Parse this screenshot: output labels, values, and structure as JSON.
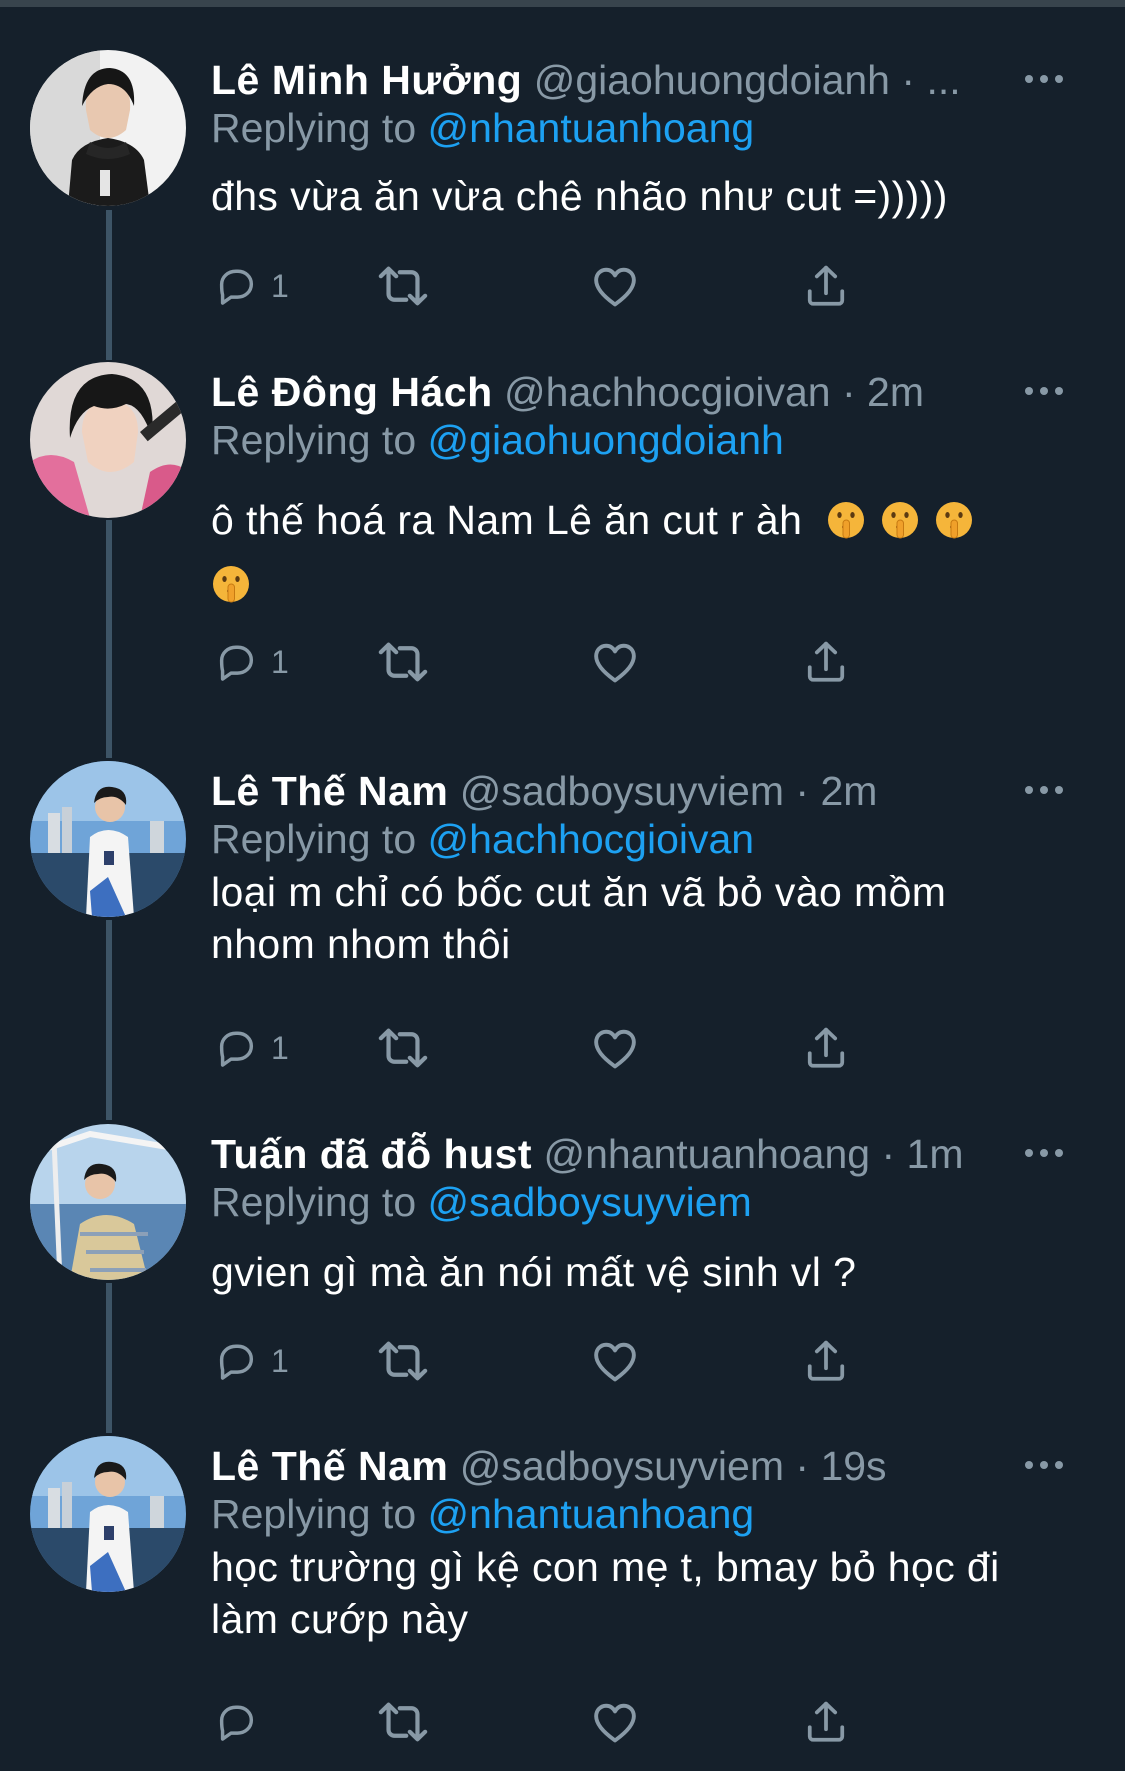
{
  "replying_prefix": "Replying to",
  "tweets": [
    {
      "name": "Lê Minh Hưởng",
      "handle": "@giaohuongdoianh",
      "time": "· ...",
      "reply_to": "@nhantuanhoang",
      "text": "đhs vừa ăn vừa chê nhão như cut =)))))",
      "emojis": 0,
      "reply_count": "1"
    },
    {
      "name": "Lê Đông Hách",
      "handle": "@hachhocgioivan",
      "time": "· 2m",
      "reply_to": "@giaohuongdoianh",
      "text": "ô thế hoá ra Nam Lê ăn cut r àh",
      "emojis": 4,
      "emoji_name": "shushing-face",
      "reply_count": "1"
    },
    {
      "name": "Lê Thế Nam",
      "handle": "@sadboysuyviem",
      "time": "· 2m",
      "reply_to": "@hachhocgioivan",
      "text": "loại m chỉ có bốc cut ăn vã bỏ vào mồm nhom nhom thôi",
      "emojis": 0,
      "reply_count": "1"
    },
    {
      "name": "Tuấn đã đỗ hust",
      "handle": "@nhantuanhoang",
      "time": "· 1m",
      "reply_to": "@sadboysuyviem",
      "text": "gvien gì mà ăn nói mất vệ sinh vl ?",
      "emojis": 0,
      "reply_count": "1"
    },
    {
      "name": "Lê Thế Nam",
      "handle": "@sadboysuyviem",
      "time": "· 19s",
      "reply_to": "@nhantuanhoang",
      "text": "học trường gì kệ con mẹ t, bmay bỏ học đi làm cướp này",
      "emojis": 0,
      "reply_count": ""
    }
  ],
  "icons": {
    "reply": "reply-icon",
    "retweet": "retweet-icon",
    "like": "heart-icon",
    "share": "share-icon",
    "more": "more-dots-icon"
  },
  "colors": {
    "background": "#15202b",
    "secondary_text": "#8899a6",
    "mention": "#1da1f2",
    "thread_line": "#3d5466"
  }
}
